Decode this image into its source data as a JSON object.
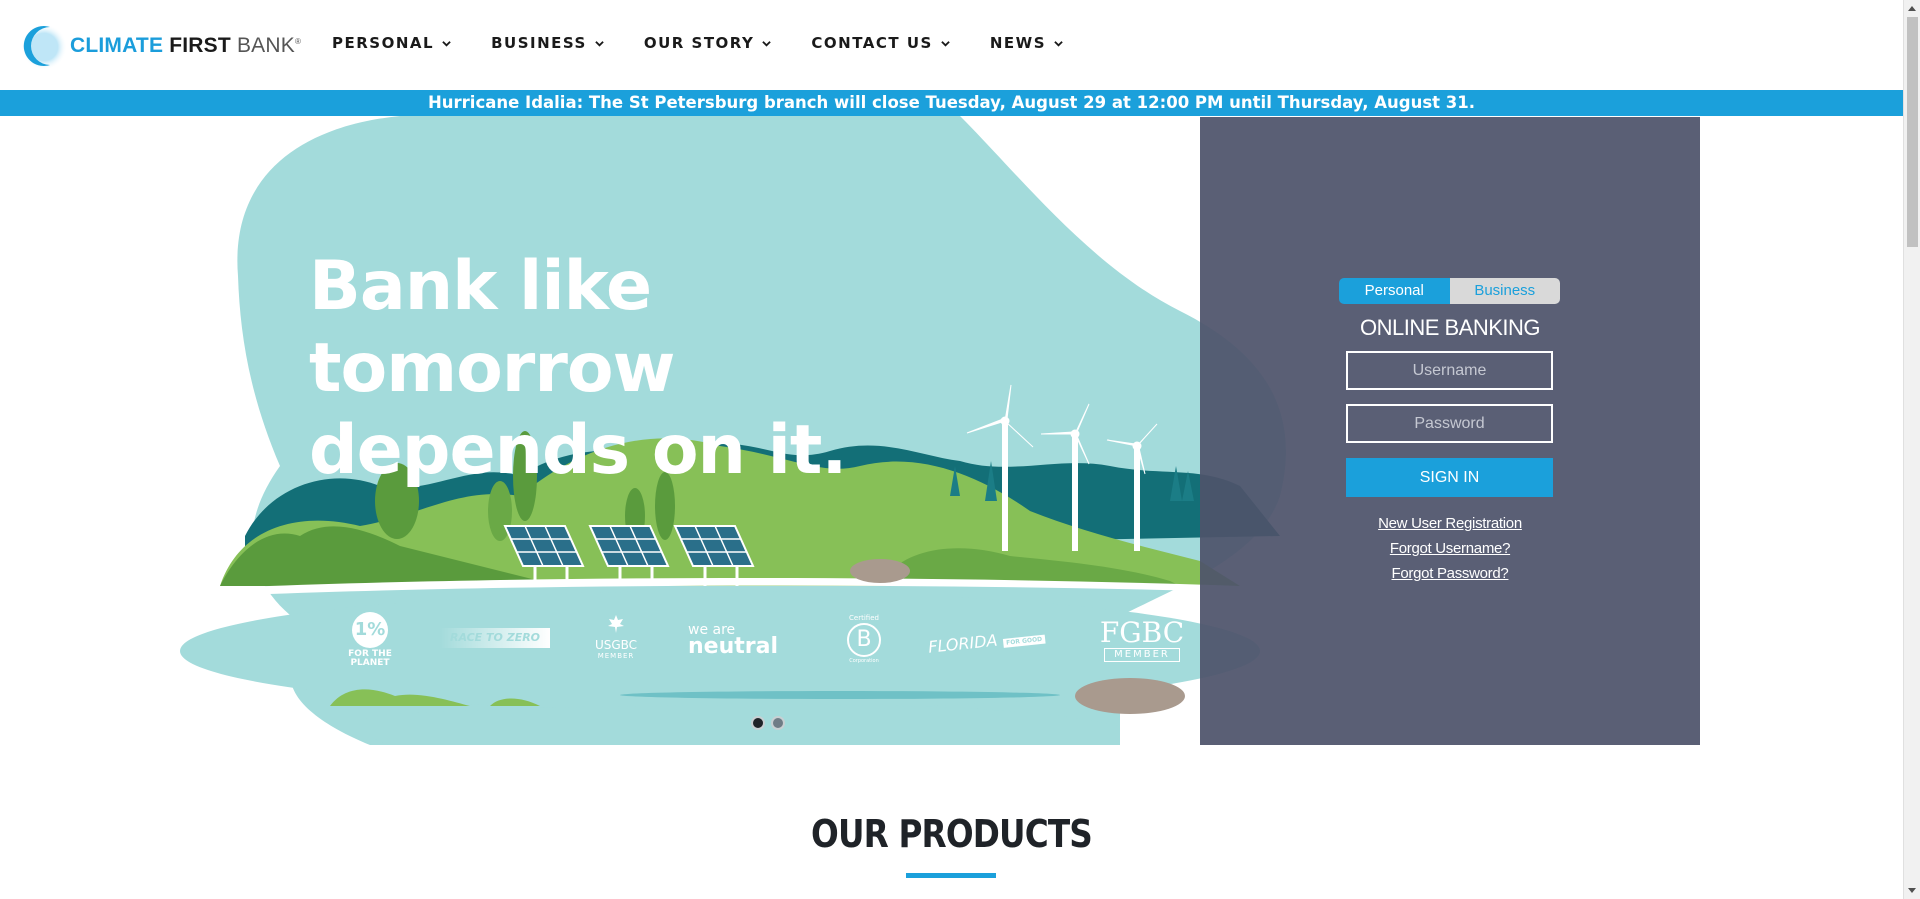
{
  "logo": {
    "word1": "CLIMATE",
    "word2": "FIRST",
    "word3": "BANK",
    "mark": "®"
  },
  "nav": {
    "items": [
      {
        "label": "PERSONAL"
      },
      {
        "label": "BUSINESS"
      },
      {
        "label": "OUR STORY"
      },
      {
        "label": "CONTACT US"
      },
      {
        "label": "NEWS"
      }
    ]
  },
  "alert": {
    "text": "Hurricane Idalia: The St Petersburg branch will close Tuesday, August 29 at 12:00 PM until Thursday, August 31."
  },
  "hero": {
    "title_line1": "Bank like tomorrow",
    "title_line2": "depends on it.",
    "badges": {
      "one_percent": "1%",
      "for_the_planet": "FOR THE PLANET",
      "race_to_zero": "RACE TO ZERO",
      "usgbc": "USGBC",
      "usgbc_member": "MEMBER",
      "we_are": "we are",
      "neutral": "neutral",
      "certified": "Certified",
      "b": "B",
      "corporation": "Corporation",
      "florida": "FLORIDA",
      "for_good": "FOR GOOD",
      "fgbc": "FGBC",
      "fgbc_member": "MEMBER"
    },
    "carousel": {
      "count": 2,
      "active": 0
    }
  },
  "login": {
    "tabs": {
      "personal": "Personal",
      "business": "Business"
    },
    "title": "ONLINE BANKING",
    "username_placeholder": "Username",
    "password_placeholder": "Password",
    "sign_in": "SIGN IN",
    "links": {
      "new_user": "New User Registration",
      "forgot_username": "Forgot Username?",
      "forgot_password": "Forgot Password?"
    }
  },
  "products": {
    "title": "OUR PRODUCTS"
  },
  "colors": {
    "accent": "#1ba0db",
    "hero_bg": "#a3dbdb",
    "panel": "#4e536a"
  }
}
